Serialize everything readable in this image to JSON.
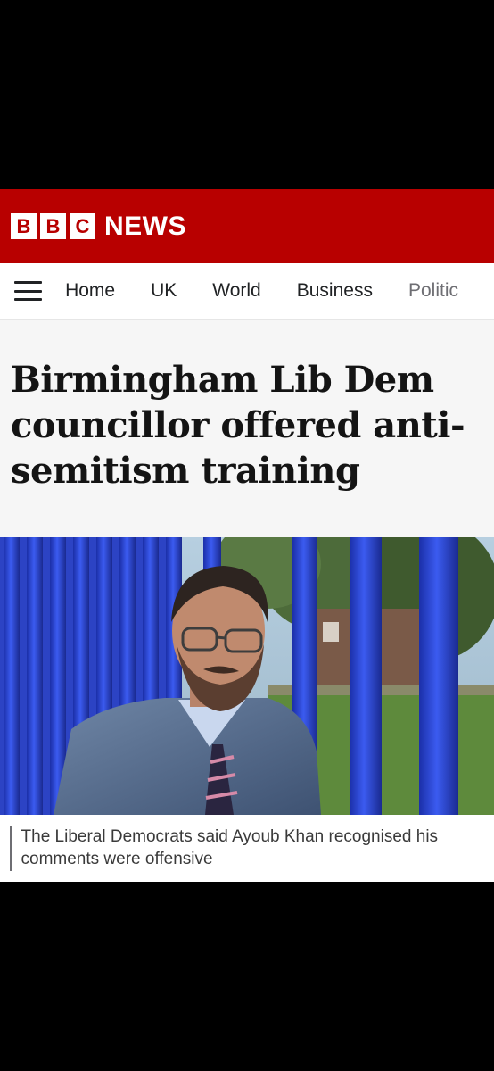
{
  "brand": {
    "letters": [
      "B",
      "B",
      "C"
    ],
    "news": "NEWS",
    "red": "#b80000"
  },
  "nav": {
    "menu_icon": "hamburger-menu-icon",
    "items": [
      "Home",
      "UK",
      "World",
      "Business",
      "Politic"
    ]
  },
  "article": {
    "headline": "Birmingham Lib Dem councillor offered anti-semitism training",
    "image_caption": "The Liberal Democrats said Ayoub Khan recognised his comments were offensive"
  }
}
